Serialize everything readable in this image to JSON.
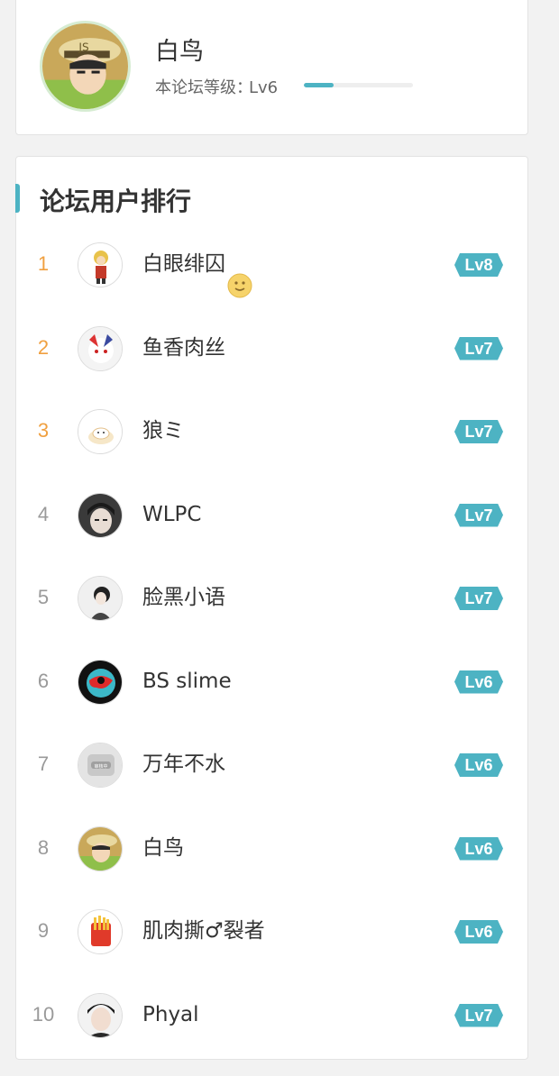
{
  "profile": {
    "name": "白鸟",
    "level_label": "本论坛等级：",
    "level": "Lv6",
    "progress": 0.27
  },
  "ranking": {
    "title": "论坛用户排行",
    "users": [
      {
        "rank": "1",
        "name": "白眼绯囚",
        "level": "Lv8",
        "emoji": "slightly-smiling-face-icon"
      },
      {
        "rank": "2",
        "name": "鱼香肉丝",
        "level": "Lv7"
      },
      {
        "rank": "3",
        "name": "狼ミ",
        "level": "Lv7"
      },
      {
        "rank": "4",
        "name": "WLPC",
        "level": "Lv7"
      },
      {
        "rank": "5",
        "name": "脸黑小语",
        "level": "Lv7"
      },
      {
        "rank": "6",
        "name": "BS slime",
        "level": "Lv6"
      },
      {
        "rank": "7",
        "name": "万年不水",
        "level": "Lv6"
      },
      {
        "rank": "8",
        "name": "白鸟",
        "level": "Lv6"
      },
      {
        "rank": "9",
        "name": "肌肉撕♂裂者",
        "level": "Lv6"
      },
      {
        "rank": "10",
        "name": "Phyal",
        "level": "Lv7"
      }
    ]
  },
  "colors": {
    "accent": "#4db3c3",
    "top_rank": "#f0a040",
    "rank": "#9a9a9a"
  }
}
